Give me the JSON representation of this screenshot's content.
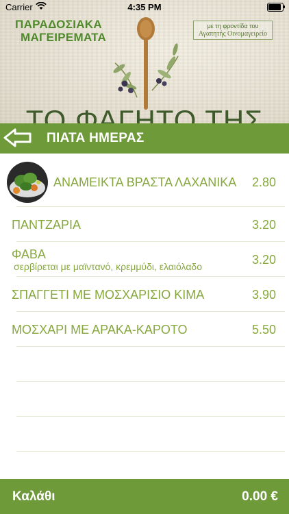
{
  "status_bar": {
    "carrier": "Carrier",
    "time": "4:35 PM"
  },
  "banner": {
    "brand_line1": "ΠΑΡΑΔΟΣΙΑΚΑ",
    "brand_line2": "ΜΑΓΕΙΡΕΜΑΤΑ",
    "care_line1": "με τη φροντίδα του",
    "care_line2": "Αγαπητής Οινομαγειρείο",
    "tagline": "ΤΟ ΦΑΓΗΤΟ ΤΗΣ ΖΩΗΣ"
  },
  "header": {
    "title": "ΠΙΑΤΑ ΗΜΕΡΑΣ",
    "back_icon": "back-arrow-icon"
  },
  "menu": {
    "items": [
      {
        "name": "ΑΝΑΜΕΙΚΤΑ ΒΡΑΣΤΑ ΛΑΧΑΝΙΚΑ",
        "description": "",
        "price": "2.80"
      },
      {
        "name": "ΠΑΝΤΖΑΡΙΑ",
        "description": "",
        "price": "3.20"
      },
      {
        "name": "ΦΑΒΑ",
        "description": "σερβίρεται με μαϊντανό, κρεμμύδι, ελαιόλαδο",
        "price": "3.20"
      },
      {
        "name": "ΣΠΑΓΓΕΤΙ ΜΕ ΜΟΣΧΑΡΙΣΙΟ ΚΙΜΑ",
        "description": "",
        "price": "3.90"
      },
      {
        "name": "ΜΟΣΧΑΡΙ ΜΕ ΑΡΑΚΑ-ΚΑΡΟΤΟ",
        "description": "",
        "price": "5.50"
      }
    ]
  },
  "cart": {
    "label": "Καλάθι",
    "total": "0.00 €"
  },
  "colors": {
    "accent_green": "#6e9a3a",
    "text_green": "#87a83f"
  }
}
